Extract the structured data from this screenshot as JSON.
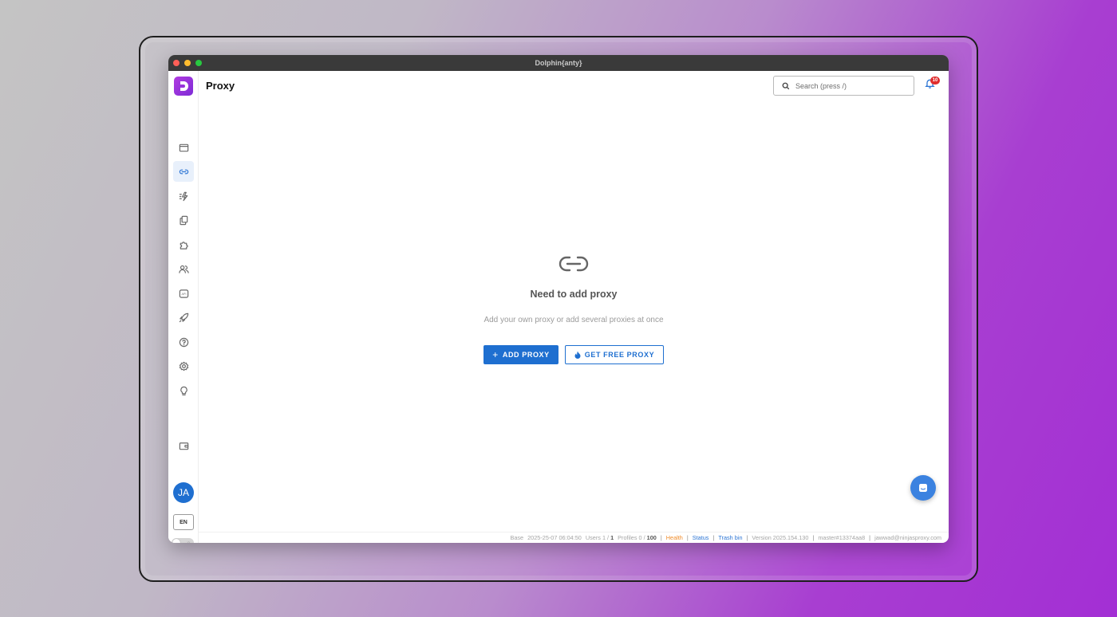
{
  "window": {
    "title": "Dolphin{anty}"
  },
  "header": {
    "title": "Proxy",
    "search_placeholder": "Search (press /)",
    "notifications_count": "10"
  },
  "sidebar": {
    "items": [
      {
        "icon": "browser-window-icon"
      },
      {
        "icon": "link-icon",
        "active": true
      },
      {
        "icon": "automation-icon"
      },
      {
        "icon": "copy-icon"
      },
      {
        "icon": "puzzle-icon"
      },
      {
        "icon": "users-icon"
      },
      {
        "icon": "api-icon"
      },
      {
        "icon": "rocket-icon"
      },
      {
        "icon": "help-icon"
      },
      {
        "icon": "settings-icon"
      },
      {
        "icon": "lightbulb-icon"
      }
    ],
    "wallet_icon": "wallet-icon",
    "avatar_initials": "JA",
    "language": "EN"
  },
  "empty_state": {
    "title": "Need to add proxy",
    "subtitle": "Add your own proxy or add several proxies at once",
    "add_button": "ADD PROXY",
    "free_button": "GET FREE PROXY"
  },
  "footer": {
    "base_label": "Base",
    "base_date": "2025-25-07 06:04:50",
    "users_label": "Users 1 /",
    "users_max": "1",
    "profiles_label": "Profiles 0 /",
    "profiles_max": "100",
    "health": "Health",
    "status": "Status",
    "trash": "Trash bin",
    "version": "Version 2025.154.130",
    "branch": "master#13374aa8",
    "email": "jawwad@ninjasproxy.com"
  },
  "colors": {
    "accent": "#1e6fd0",
    "logo": "#9b36dc",
    "badge": "#e02d2d",
    "health": "#f08c2a"
  }
}
